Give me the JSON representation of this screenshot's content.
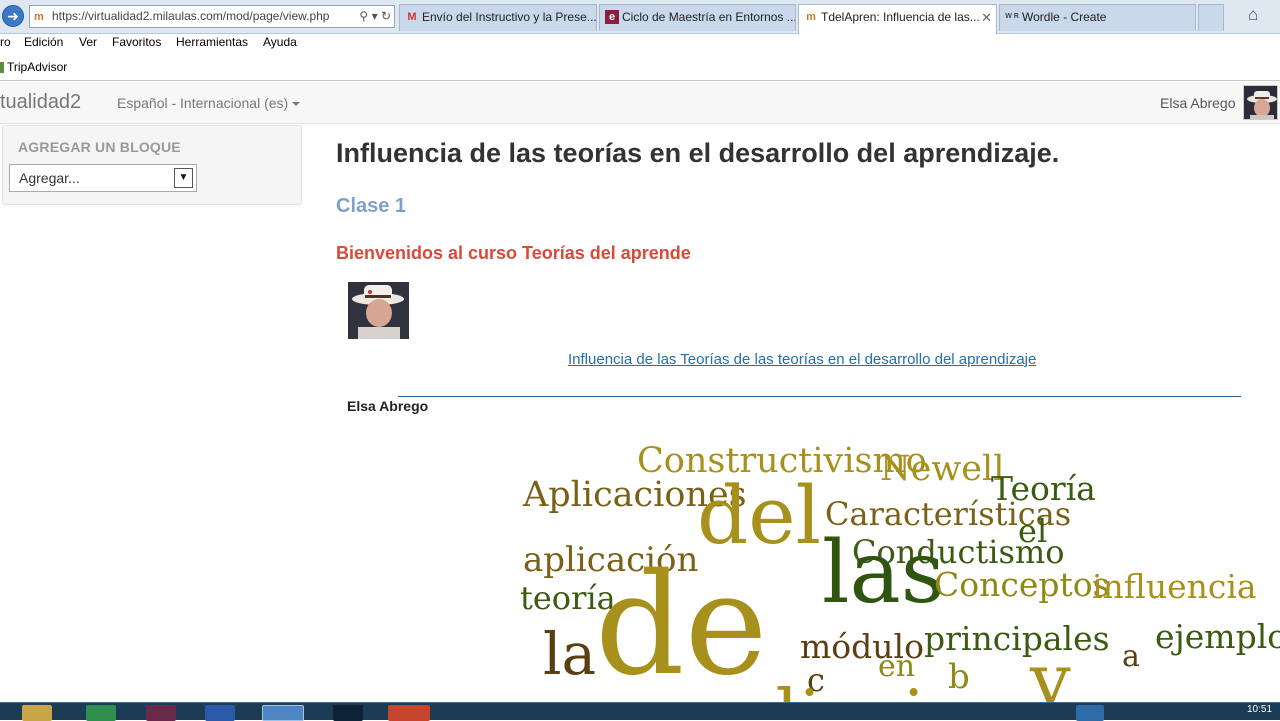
{
  "browser": {
    "address_url": "https://virtualidad2.milaulas.com/mod/page/view.php",
    "tabs": [
      {
        "label": "Envío del Instructivo y la Prese..."
      },
      {
        "label": "Ciclo de Maestría en Entornos ..."
      },
      {
        "label": "TdelApren: Influencia de las..."
      },
      {
        "label": "Wordle - Create"
      }
    ],
    "menu": [
      "ro",
      "Edición",
      "Ver",
      "Favoritos",
      "Herramientas",
      "Ayuda"
    ],
    "favorites": [
      "TripAdvisor"
    ]
  },
  "site": {
    "brand": "tualidad2",
    "language": "Español - Internacional (es)",
    "user": "Elsa Abrego"
  },
  "block": {
    "title": "AGREGAR UN BLOQUE",
    "select_value": "Agregar..."
  },
  "content": {
    "title": "Influencia de las teorías en el desarrollo del aprendizaje.",
    "clase": "Clase 1",
    "welcome": "Bienvenidos al curso Teorías del aprende",
    "link": "Influencia de las Teorías de las teorías en el desarrollo del aprendizaje ",
    "author": "Elsa Abrego"
  },
  "wordcloud": [
    {
      "text": "Constructivismo",
      "color": "#a7901b"
    },
    {
      "text": "Newell",
      "color": "#a7901b"
    },
    {
      "text": "Teoría",
      "color": "#3b5a12"
    },
    {
      "text": "Aplicaciones",
      "color": "#7a6118"
    },
    {
      "text": "Características",
      "color": "#7a6118"
    },
    {
      "text": "del",
      "color": "#a7901b"
    },
    {
      "text": "el",
      "color": "#3b5a12"
    },
    {
      "text": "Conductismo",
      "color": "#3b5a12"
    },
    {
      "text": "aplicación",
      "color": "#7a6118"
    },
    {
      "text": "las",
      "color": "#2f5510"
    },
    {
      "text": "Conceptos",
      "color": "#8d8a16"
    },
    {
      "text": "influencia",
      "color": "#a7901b"
    },
    {
      "text": "teoría",
      "color": "#3b5a12"
    },
    {
      "text": "de",
      "color": "#a7901b"
    },
    {
      "text": "módulo",
      "color": "#5a3f12"
    },
    {
      "text": "principales",
      "color": "#3b5a12"
    },
    {
      "text": "ejemplos",
      "color": "#3b5a12"
    },
    {
      "text": "la",
      "color": "#5a3f12"
    },
    {
      "text": "en",
      "color": "#8d8a16"
    },
    {
      "text": "a",
      "color": "#5a3f12"
    },
    {
      "text": "b",
      "color": "#8d8a16"
    },
    {
      "text": "c",
      "color": "#5a3f12"
    },
    {
      "text": "y",
      "color": "#a7901b"
    },
    {
      "text": "aprendizaje",
      "color": "#a7901b"
    }
  ],
  "system": {
    "clock": "10:51"
  }
}
